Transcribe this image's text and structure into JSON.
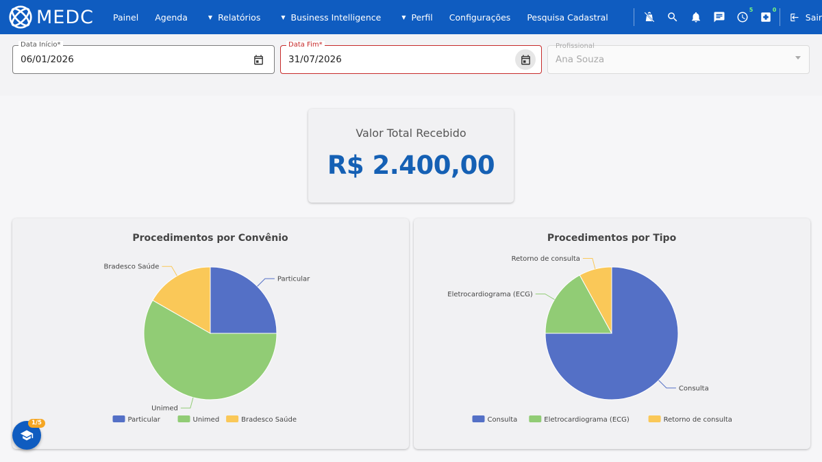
{
  "brand": {
    "name": "MEDC"
  },
  "nav": {
    "items": [
      {
        "label": "Painel",
        "caret": false
      },
      {
        "label": "Agenda",
        "caret": false
      },
      {
        "label": "Relatórios",
        "caret": true
      },
      {
        "label": "Business Intelligence",
        "caret": true
      },
      {
        "label": "Perfil",
        "caret": true
      },
      {
        "label": "Configurações",
        "caret": false
      },
      {
        "label": "Pesquisa Cadastral",
        "caret": false
      }
    ],
    "tools": [
      {
        "icon": "no-cart-icon",
        "badge": ""
      },
      {
        "icon": "search-icon",
        "badge": ""
      },
      {
        "icon": "bell-icon",
        "badge": ""
      },
      {
        "icon": "chat-icon",
        "badge": ""
      },
      {
        "icon": "clock-icon",
        "badge": "5"
      },
      {
        "icon": "medical-box-icon",
        "badge": "0"
      }
    ],
    "logout_label": "Sair"
  },
  "filters": {
    "start": {
      "label": "Data Início*",
      "value": "06/01/2026"
    },
    "end": {
      "label": "Data Fim*",
      "value": "31/07/2026"
    },
    "professional": {
      "label": "Profissional",
      "value": "Ana Souza"
    }
  },
  "kpi": {
    "title": "Valor Total Recebido",
    "value": "R$ 2.400,00"
  },
  "chart_data": [
    {
      "type": "pie",
      "title": "Procedimentos por Convênio",
      "categories": [
        "Particular",
        "Unimed",
        "Bradesco Saúde"
      ],
      "values": [
        25,
        58.3,
        16.7
      ],
      "colors": [
        "#5470c6",
        "#91cc75",
        "#fac858"
      ],
      "legend": "bottom"
    },
    {
      "type": "pie",
      "title": "Procedimentos por Tipo",
      "categories": [
        "Consulta",
        "Eletrocardiograma (ECG)",
        "Retorno de consulta"
      ],
      "values": [
        75,
        17,
        8
      ],
      "colors": [
        "#5470c6",
        "#91cc75",
        "#fac858"
      ],
      "legend": "bottom"
    }
  ],
  "help": {
    "badge": "1/5"
  }
}
